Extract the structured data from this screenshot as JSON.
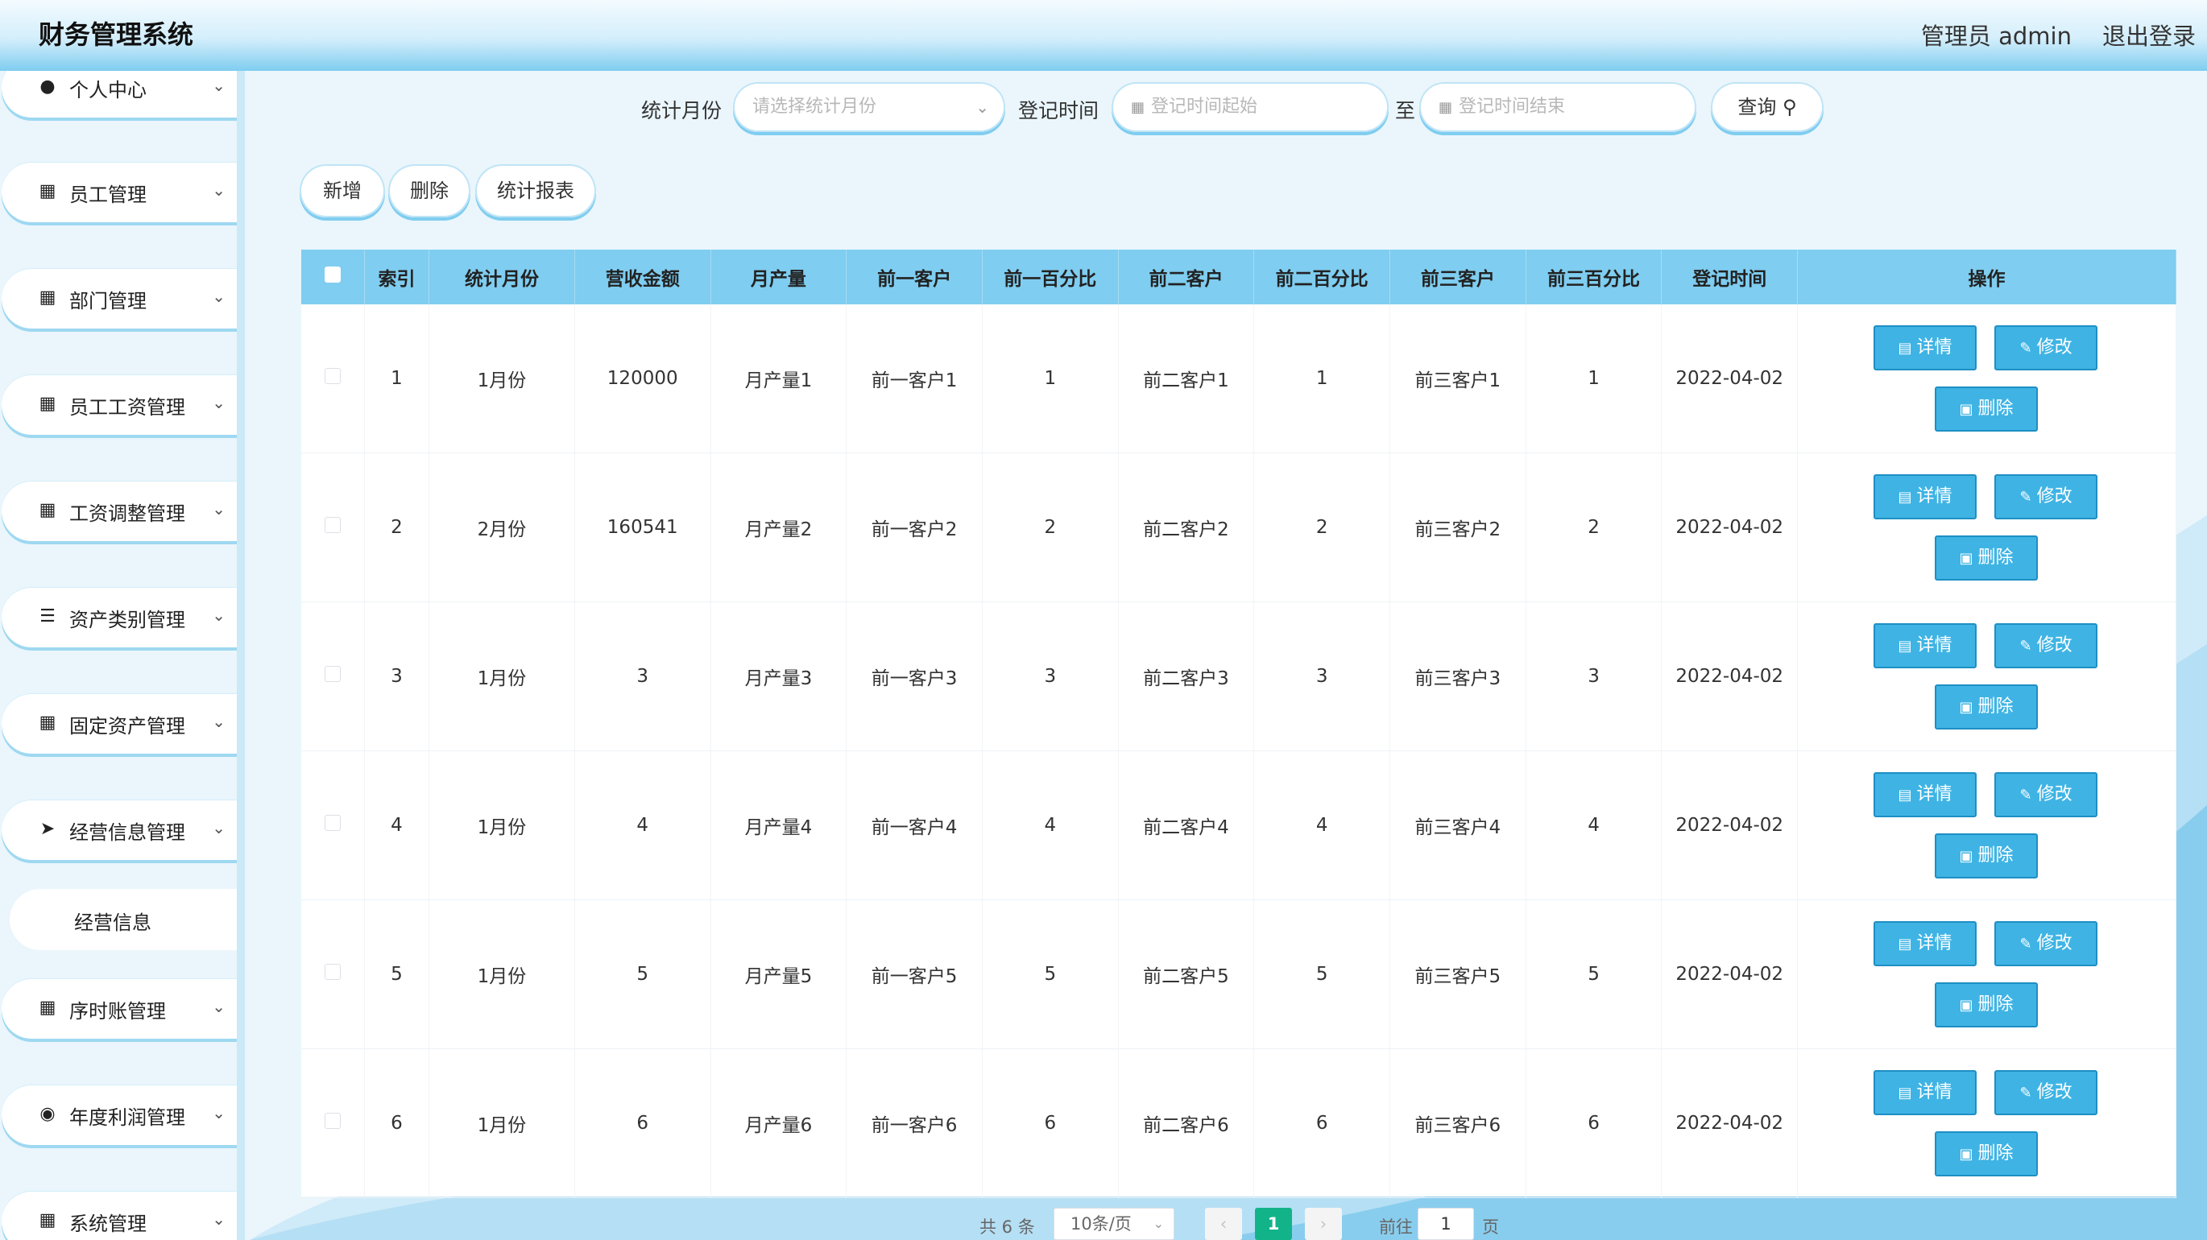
{
  "header": {
    "title": "财务管理系统",
    "user": "管理员 admin",
    "logout": "退出登录"
  },
  "sidebar": {
    "items": [
      {
        "label": "个人中心",
        "icon": "user-icon"
      },
      {
        "label": "员工管理",
        "icon": "grid-icon"
      },
      {
        "label": "部门管理",
        "icon": "grid-icon"
      },
      {
        "label": "员工工资管理",
        "icon": "grid-icon"
      },
      {
        "label": "工资调整管理",
        "icon": "grid-icon"
      },
      {
        "label": "资产类别管理",
        "icon": "list-icon"
      },
      {
        "label": "固定资产管理",
        "icon": "grid-icon"
      },
      {
        "label": "经营信息管理",
        "icon": "send-icon"
      },
      {
        "label": "序时账管理",
        "icon": "grid-icon"
      },
      {
        "label": "年度利润管理",
        "icon": "location-icon"
      },
      {
        "label": "系统管理",
        "icon": "grid-icon"
      }
    ],
    "sub_item": "经营信息"
  },
  "search": {
    "month_label": "统计月份",
    "month_placeholder": "请选择统计月份",
    "time_label": "登记时间",
    "start_placeholder": "登记时间起始",
    "to": "至",
    "end_placeholder": "登记时间结束",
    "query": "查询"
  },
  "actions": {
    "add": "新增",
    "delete": "删除",
    "report": "统计报表"
  },
  "table": {
    "headers": [
      "索引",
      "统计月份",
      "营收金额",
      "月产量",
      "前一客户",
      "前一百分比",
      "前二客户",
      "前二百分比",
      "前三客户",
      "前三百分比",
      "登记时间",
      "操作"
    ],
    "rows": [
      [
        "1",
        "1月份",
        "120000",
        "月产量1",
        "前一客户1",
        "1",
        "前二客户1",
        "1",
        "前三客户1",
        "1",
        "2022-04-02"
      ],
      [
        "2",
        "2月份",
        "160541",
        "月产量2",
        "前一客户2",
        "2",
        "前二客户2",
        "2",
        "前三客户2",
        "2",
        "2022-04-02"
      ],
      [
        "3",
        "1月份",
        "3",
        "月产量3",
        "前一客户3",
        "3",
        "前二客户3",
        "3",
        "前三客户3",
        "3",
        "2022-04-02"
      ],
      [
        "4",
        "1月份",
        "4",
        "月产量4",
        "前一客户4",
        "4",
        "前二客户4",
        "4",
        "前三客户4",
        "4",
        "2022-04-02"
      ],
      [
        "5",
        "1月份",
        "5",
        "月产量5",
        "前一客户5",
        "5",
        "前二客户5",
        "5",
        "前三客户5",
        "5",
        "2022-04-02"
      ],
      [
        "6",
        "1月份",
        "6",
        "月产量6",
        "前一客户6",
        "6",
        "前二客户6",
        "6",
        "前三客户6",
        "6",
        "2022-04-02"
      ]
    ],
    "op_detail": "详情",
    "op_edit": "修改",
    "op_delete": "删除"
  },
  "pagination": {
    "total": "共 6 条",
    "page_size": "10条/页",
    "current": "1",
    "goto_label": "前往",
    "goto_value": "1",
    "page_word": "页"
  },
  "colors": {
    "accent": "#7fcdf0",
    "button": "#3fb4e4",
    "pager_active": "#13b38a"
  }
}
